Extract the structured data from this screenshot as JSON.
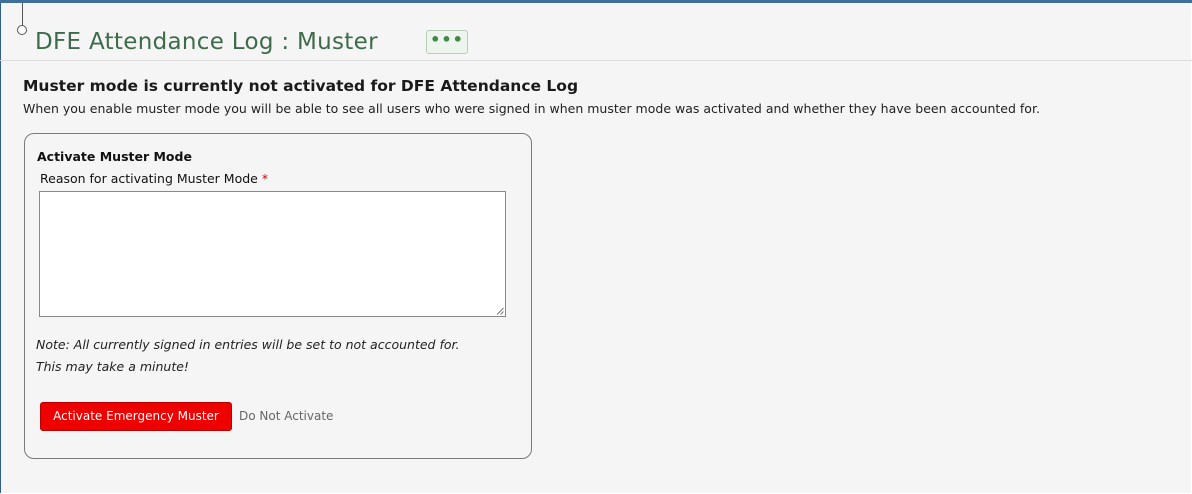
{
  "header": {
    "title": "DFE Attendance Log : Muster",
    "more_label": "•••"
  },
  "status": {
    "heading": "Muster mode is currently not activated for DFE Attendance Log",
    "description": "When you enable muster mode you will be able to see all users who were signed in when muster mode was activated and whether they have been accounted for."
  },
  "form": {
    "title": "Activate Muster Mode",
    "reason_label": "Reason for activating Muster Mode",
    "required_marker": "*",
    "reason_value": "",
    "note_line1": "Note: All currently signed in entries will be set to not accounted for.",
    "note_line2": "This may take a minute!",
    "activate_label": "Activate Emergency Muster",
    "cancel_label": "Do Not Activate"
  },
  "colors": {
    "title": "#3e6b4a",
    "accent_button": "#ee0000",
    "required": "#dd0000",
    "frame": "#2e5e8c"
  }
}
